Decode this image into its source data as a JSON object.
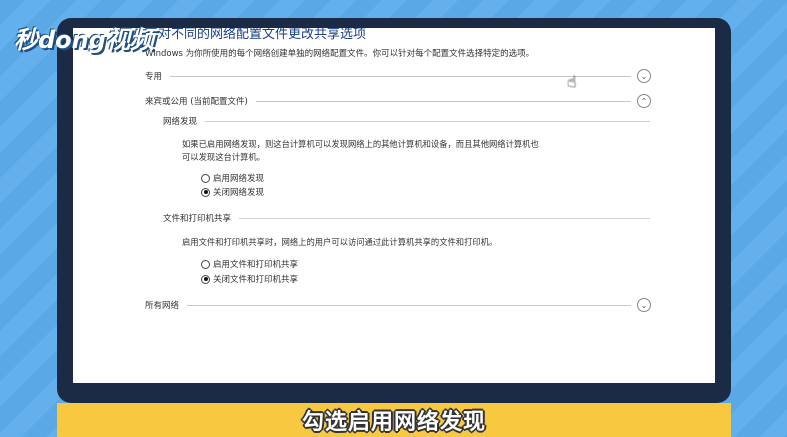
{
  "watermark": {
    "logo_text": "秒dong视频"
  },
  "window": {
    "title": "针对不同的网络配置文件更改共享选项",
    "description": "Windows 为你所使用的每个网络创建单独的网络配置文件。你可以针对每个配置文件选择特定的选项。"
  },
  "sections": {
    "private": {
      "label": "专用",
      "state": "collapsed"
    },
    "guest_public": {
      "label": "来宾或公用 (当前配置文件)",
      "state": "expanded"
    },
    "all_networks": {
      "label": "所有网络",
      "state": "collapsed"
    }
  },
  "network_discovery": {
    "heading": "网络发现",
    "description_line1": "如果已启用网络发现，则这台计算机可以发现网络上的其他计算机和设备，而且其他网络计算机也",
    "description_line2": "可以发现这台计算机。",
    "options": [
      {
        "label": "启用网络发现",
        "checked": false
      },
      {
        "label": "关闭网络发现",
        "checked": true
      }
    ]
  },
  "file_printer_sharing": {
    "heading": "文件和打印机共享",
    "description": "启用文件和打印机共享时，网络上的用户可以访问通过此计算机共享的文件和打印机。",
    "options": [
      {
        "label": "启用文件和打印机共享",
        "checked": false
      },
      {
        "label": "关闭文件和打印机共享",
        "checked": true
      }
    ]
  },
  "icons": {
    "expand": "chevron-down-icon",
    "collapse": "chevron-up-icon",
    "pointer": "hand-cursor-icon"
  },
  "caption": {
    "text": "勾选启用网络发现"
  }
}
